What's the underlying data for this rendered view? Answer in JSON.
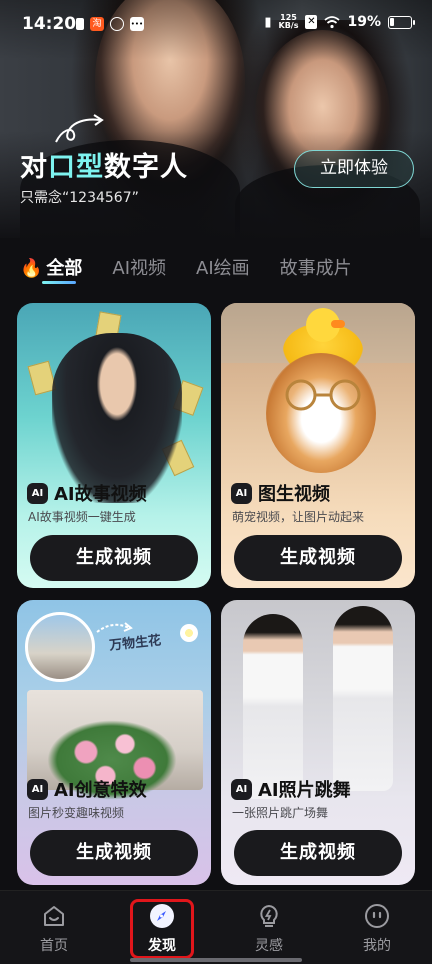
{
  "status_bar": {
    "time": "14:20",
    "net_speed_value": "125",
    "net_speed_unit": "KB/s",
    "battery": "19%",
    "battery_level": 0.19
  },
  "hero": {
    "title_prefix": "对",
    "title_highlight": "口型",
    "title_suffix": "数字人",
    "subtitle": "只需念“1234567”",
    "cta_label": "立即体验"
  },
  "tabs": [
    {
      "label": "全部",
      "active": true
    },
    {
      "label": "AI视频",
      "active": false
    },
    {
      "label": "AI绘画",
      "active": false
    },
    {
      "label": "故事成片",
      "active": false
    }
  ],
  "cards": [
    {
      "badge": "AI",
      "title": "AI故事视频",
      "desc": "AI故事视频一键生成",
      "button": "生成视频"
    },
    {
      "badge": "AI",
      "title": "图生视频",
      "desc": "萌宠视频，让图片动起来",
      "button": "生成视频"
    },
    {
      "badge": "AI",
      "title": "AI创意特效",
      "desc": "图片秒变趣味视频",
      "button": "生成视频",
      "art_tag": "万物生花"
    },
    {
      "badge": "AI",
      "title": "AI照片跳舞",
      "desc": "一张照片跳广场舞",
      "button": "生成视频"
    }
  ],
  "nav": [
    {
      "label": "首页",
      "icon": "home-face-icon",
      "active": false
    },
    {
      "label": "发现",
      "icon": "compass-icon",
      "active": true
    },
    {
      "label": "灵感",
      "icon": "lightbulb-bolt-icon",
      "active": false
    },
    {
      "label": "我的",
      "icon": "profile-face-icon",
      "active": false
    }
  ],
  "colors": {
    "accent_cyan": "#7ef3f0",
    "flame": "#ff6a3d",
    "highlight_box": "#e1161b"
  }
}
